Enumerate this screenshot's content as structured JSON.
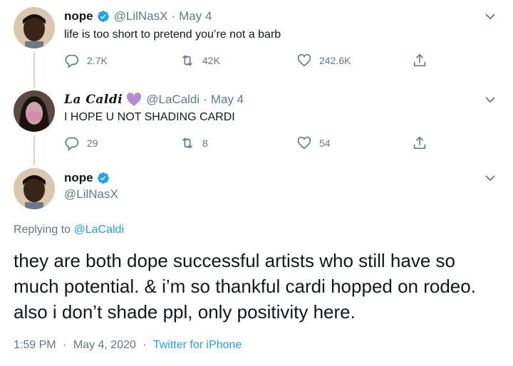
{
  "tweets": [
    {
      "name": "nope",
      "verified": true,
      "handle": "@LilNasX",
      "separator": "·",
      "date": "May 4",
      "text": "life is too short to pretend you’re not a barb",
      "replies": "2.7K",
      "retweets": "42K",
      "likes": "242.6K"
    },
    {
      "name": "La Caldi",
      "badge_emoji": "purple-heart-icon",
      "handle": "@LaCaldi",
      "separator": "·",
      "date": "May 4",
      "text": "I HOPE U NOT SHADING CARDI",
      "replies": "29",
      "retweets": "8",
      "likes": "54"
    }
  ],
  "main_tweet": {
    "name": "nope",
    "verified": true,
    "handle": "@LilNasX",
    "replying_prefix": "Replying to",
    "replying_to": "@LaCaldi",
    "text": "they are both dope successful artists who still have so much potential. & i’m so thankful cardi hopped on rodeo. also i don’t shade ppl, only positivity here.",
    "time": "1:59 PM",
    "separator": "·",
    "date": "May 4, 2020",
    "source": "Twitter for iPhone"
  },
  "colors": {
    "accent": "#1da1f2",
    "secondary_text": "#657786",
    "thread_line": "#ccd6dd",
    "heart_badge": "#b58ad8"
  }
}
